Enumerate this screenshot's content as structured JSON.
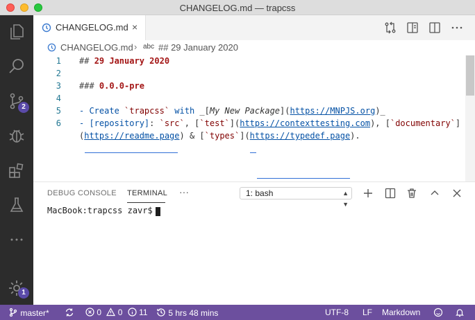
{
  "window": {
    "title": "CHANGELOG.md — trapcss"
  },
  "activity_bar": {
    "scm_badge": "2",
    "manage_badge": "1"
  },
  "tabs": [
    {
      "label": "CHANGELOG.md",
      "close": "×"
    }
  ],
  "breadcrumb": {
    "file": "CHANGELOG.md",
    "separator": "›",
    "symbol_kind": "abc",
    "symbol": "## 29 January 2020"
  },
  "editor": {
    "line_numbers": [
      "1",
      "2",
      "3",
      "4",
      "5",
      "6"
    ],
    "line1": {
      "hashes": "## ",
      "text": "29 January 2020"
    },
    "line3": {
      "hashes": "### ",
      "text": "0.0.0-pre"
    },
    "line5": {
      "bullet": "- ",
      "t1": "Create ",
      "t2": "`trapcss`",
      "t3": " with ",
      "t4": "_[",
      "t5": "My New Package",
      "t6": "](",
      "t7": "https://MNPJS.org",
      "t8": ")_"
    },
    "line6": {
      "bullet": "- ",
      "t1": "[repository]",
      "t2": ": ",
      "t3": "`src`",
      "t4": ", [",
      "t5": "`test`",
      "t6": "](",
      "t7": "https://contexttesting.com",
      "t8": "), [",
      "t9": "`documentary`",
      "t10": "]"
    },
    "line6b": {
      "t1": "(",
      "t2": "https://readme.page",
      "t3": ") & [",
      "t4": "`types`",
      "t5": "](",
      "t6": "https://typedef.page",
      "t7": ")."
    }
  },
  "panel": {
    "tabs": [
      "DEBUG CONSOLE",
      "TERMINAL"
    ],
    "more": "···",
    "terminal_select": "1: bash",
    "terminal_text": "MacBook:trapcss zavr$ "
  },
  "status_bar": {
    "branch": "master*",
    "errors": "0",
    "warnings": "0",
    "infos": "11",
    "time": "5 hrs 48 mins",
    "encoding": "UTF-8",
    "eol": "LF",
    "language": "Markdown"
  },
  "colors": {
    "status_bar": "#6c4f9e",
    "activity_bar": "#2c2c2c",
    "badge": "#5a4aa8",
    "heading": "#a31515",
    "link": "#0451a5"
  }
}
